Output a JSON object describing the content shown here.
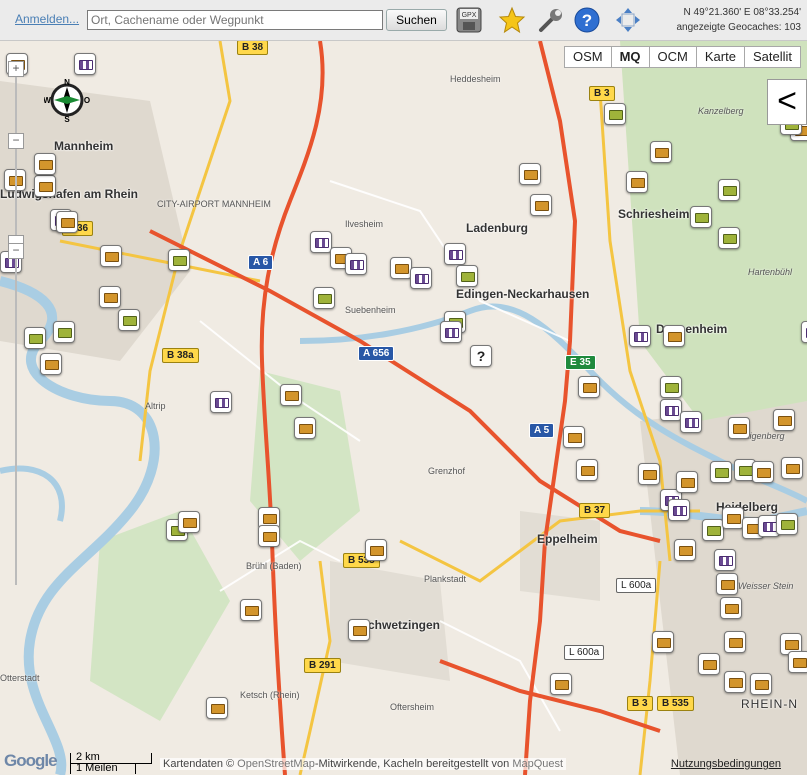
{
  "toolbar": {
    "login": "Anmelden...",
    "search_placeholder": "Ort, Cachename oder Wegpunkt",
    "search_button": "Suchen",
    "gpx_label": "GPX",
    "coords": "N 49°21.360'  E 08°33.254'",
    "shown_caches": "angezeigte Geocaches: 103"
  },
  "map_types": [
    "OSM",
    "MQ",
    "OCM",
    "Karte",
    "Satellit"
  ],
  "active_map_type": "MQ",
  "collapse_label": "<",
  "zoom": {
    "plus": "+",
    "minus": "−"
  },
  "compass": {
    "north": "N",
    "west": "W",
    "east": "O",
    "south": "S"
  },
  "towns": [
    "Mannheim",
    "Ludwigshafen am Rhein",
    "Ladenburg",
    "Edingen-Neckarhausen",
    "Schriesheim",
    "Dossenheim",
    "Eppelheim",
    "Schwetzingen",
    "Heidelberg",
    "RHEIN-N"
  ],
  "small_labels": [
    "Heddesheim",
    "Kanzelberg",
    "CITY-AIRPORT MANNHEIM",
    "Ilvesheim",
    "Suebenheim",
    "Altrip",
    "Grenzhof",
    "Brühl (Baden)",
    "Plankstadt",
    "Ketsch (Rhein)",
    "Oftersheim",
    "Otterstadt",
    "Hartenbühl",
    "Heiligenberg",
    "Weisser Stein"
  ],
  "roads": [
    "B 38",
    "B 3",
    "A 6",
    "A 656",
    "B 38a",
    "E 35",
    "A 5",
    "B 37",
    "B 535",
    "L 600a",
    "L 600a",
    "B 291",
    "B 3",
    "B 535",
    "B 36"
  ],
  "footer": {
    "attribution_prefix": "Kartendaten ©",
    "osm": "OpenStreetMap",
    "attribution_mid": "-Mitwirkende, Kacheln bereitgestellt von",
    "mapquest": "MapQuest",
    "terms": "Nutzungsbedingungen",
    "google": "Google",
    "scale_km": "2 km",
    "scale_mi": "1 Meilen"
  },
  "colors": {
    "motorway": "#e8532d",
    "primary": "#f4c542",
    "water": "#a9cde3",
    "forest": "#cfe2bd",
    "urban": "#dcd6cc"
  }
}
